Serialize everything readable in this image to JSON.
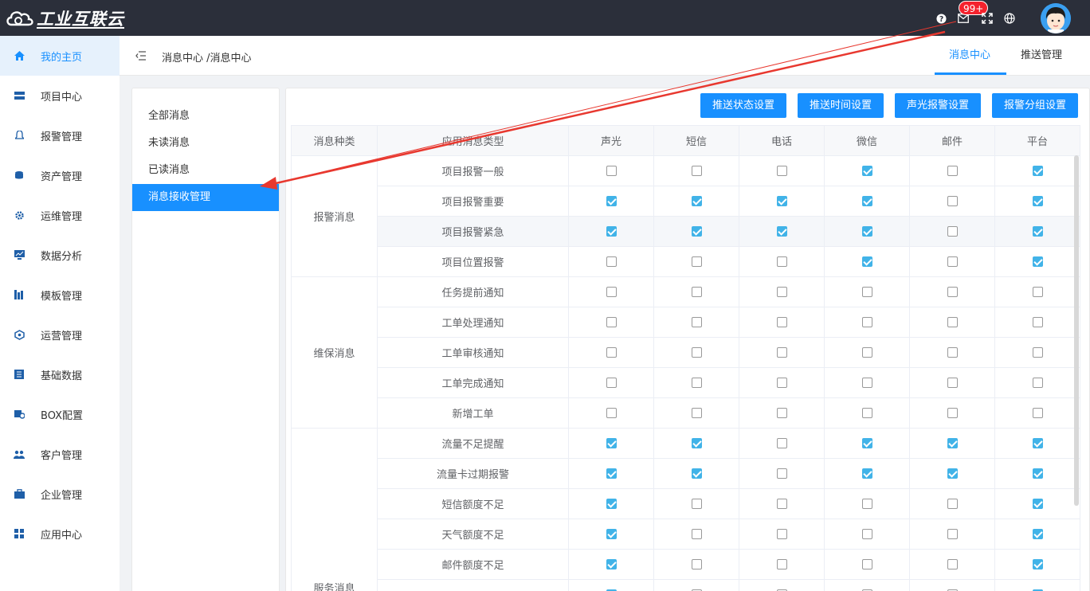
{
  "app": {
    "logo_text": "工业互联云",
    "badge": "99+"
  },
  "sidebar": {
    "items": [
      {
        "label": "我的主页",
        "icon": "home-icon"
      },
      {
        "label": "项目中心",
        "icon": "project-icon"
      },
      {
        "label": "报警管理",
        "icon": "bell-icon"
      },
      {
        "label": "资产管理",
        "icon": "asset-icon"
      },
      {
        "label": "运维管理",
        "icon": "gear-icon"
      },
      {
        "label": "数据分析",
        "icon": "chart-icon"
      },
      {
        "label": "模板管理",
        "icon": "template-icon"
      },
      {
        "label": "运营管理",
        "icon": "operation-icon"
      },
      {
        "label": "基础数据",
        "icon": "data-icon"
      },
      {
        "label": "BOX配置",
        "icon": "box-icon"
      },
      {
        "label": "客户管理",
        "icon": "users-icon"
      },
      {
        "label": "企业管理",
        "icon": "briefcase-icon"
      },
      {
        "label": "应用中心",
        "icon": "apps-icon"
      }
    ]
  },
  "header": {
    "breadcrumb": "消息中心 /消息中心",
    "tabs": [
      "消息中心",
      "推送管理"
    ]
  },
  "message_menu": {
    "items": [
      "全部消息",
      "未读消息",
      "已读消息",
      "消息接收管理"
    ]
  },
  "toolbar": {
    "buttons": [
      "推送状态设置",
      "推送时间设置",
      "声光报警设置",
      "报警分组设置"
    ]
  },
  "table": {
    "columns": [
      "消息种类",
      "应用消息类型",
      "声光",
      "短信",
      "电话",
      "微信",
      "邮件",
      "平台"
    ],
    "groups": [
      {
        "name": "报警消息",
        "rows": [
          {
            "type": "项目报警一般",
            "checks": [
              false,
              false,
              false,
              true,
              false,
              true
            ]
          },
          {
            "type": "项目报警重要",
            "checks": [
              true,
              true,
              true,
              true,
              false,
              true
            ]
          },
          {
            "type": "项目报警紧急",
            "checks": [
              true,
              true,
              true,
              true,
              false,
              true
            ]
          },
          {
            "type": "项目位置报警",
            "checks": [
              false,
              false,
              false,
              true,
              false,
              true
            ]
          }
        ]
      },
      {
        "name": "维保消息",
        "rows": [
          {
            "type": "任务提前通知",
            "checks": [
              false,
              false,
              false,
              false,
              false,
              false
            ]
          },
          {
            "type": "工单处理通知",
            "checks": [
              false,
              false,
              false,
              false,
              false,
              false
            ]
          },
          {
            "type": "工单审核通知",
            "checks": [
              false,
              false,
              false,
              false,
              false,
              false
            ]
          },
          {
            "type": "工单完成通知",
            "checks": [
              false,
              false,
              false,
              false,
              false,
              false
            ]
          },
          {
            "type": "新增工单",
            "checks": [
              false,
              false,
              false,
              false,
              false,
              false
            ]
          }
        ]
      },
      {
        "name": "服务消息",
        "rows": [
          {
            "type": "流量不足提醒",
            "checks": [
              true,
              true,
              false,
              true,
              true,
              true
            ]
          },
          {
            "type": "流量卡过期报警",
            "checks": [
              true,
              true,
              false,
              true,
              true,
              true
            ]
          },
          {
            "type": "短信额度不足",
            "checks": [
              true,
              false,
              false,
              false,
              false,
              true
            ]
          },
          {
            "type": "天气额度不足",
            "checks": [
              true,
              false,
              false,
              false,
              false,
              true
            ]
          },
          {
            "type": "邮件额度不足",
            "checks": [
              true,
              false,
              false,
              false,
              false,
              true
            ]
          },
          {
            "type": "",
            "checks": [
              true,
              false,
              false,
              false,
              false,
              true
            ]
          }
        ]
      }
    ]
  },
  "colors": {
    "topbar": "#2b2f3a",
    "accent": "#1890ff",
    "checkbox_on": "#41b3e8",
    "annotation_arrow": "#e8382f"
  }
}
